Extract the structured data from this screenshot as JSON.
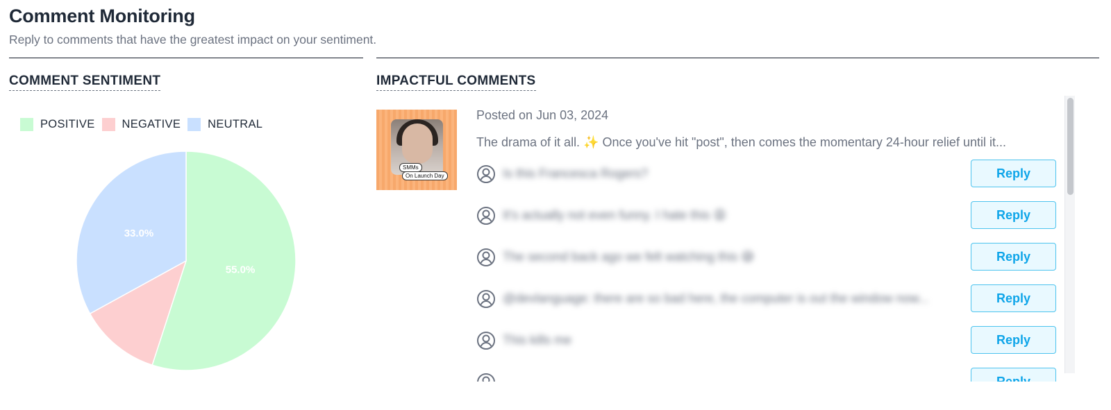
{
  "header": {
    "title": "Comment Monitoring",
    "subtitle": "Reply to comments that have the greatest impact on your sentiment."
  },
  "sentiment": {
    "label": "COMMENT SENTIMENT",
    "legend": [
      {
        "label": "POSITIVE",
        "color": "#c8fbd3"
      },
      {
        "label": "NEGATIVE",
        "color": "#fdcfd0"
      },
      {
        "label": "NEUTRAL",
        "color": "#c9e0ff"
      }
    ]
  },
  "chart_data": {
    "type": "pie",
    "slices": [
      {
        "label": "POSITIVE",
        "value": 55.0,
        "color": "#c8fbd3",
        "data_label": "55.0%"
      },
      {
        "label": "NEGATIVE",
        "value": 12.0,
        "color": "#fdcfd0",
        "data_label": ""
      },
      {
        "label": "NEUTRAL",
        "value": 33.0,
        "color": "#c9e0ff",
        "data_label": "33.0%"
      }
    ]
  },
  "impactful": {
    "label": "IMPACTFUL COMMENTS",
    "post": {
      "posted": "Posted on Jun 03, 2024",
      "caption": "The drama of it all. ✨  Once you've hit \"post\", then comes the momentary 24-hour relief until it...",
      "thumb_tag_1": "SMMs",
      "thumb_tag_2": "On Launch Day"
    },
    "comments": [
      {
        "text": "Is this Francesca Rogers?",
        "reply": "Reply"
      },
      {
        "text": "It's actually not even funny. I hate this 😩",
        "reply": "Reply"
      },
      {
        "text": "The second back ago we felt watching this 😅",
        "reply": "Reply"
      },
      {
        "text": "@devlanguage: there are so bad here, the computer is out the window now...",
        "reply": "Reply"
      },
      {
        "text": "This kills me",
        "reply": "Reply"
      },
      {
        "text": "",
        "reply": "Reply"
      }
    ]
  }
}
